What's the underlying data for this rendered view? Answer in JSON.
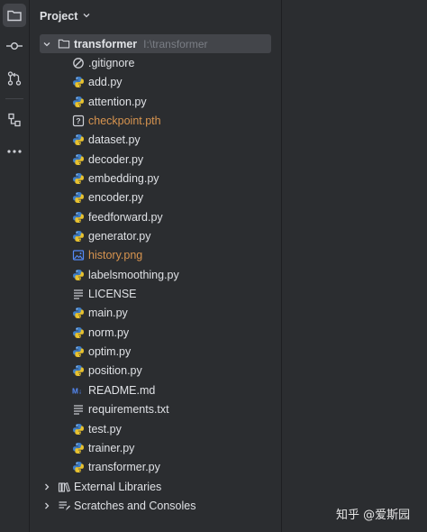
{
  "panel": {
    "title": "Project"
  },
  "root": {
    "name": "transformer",
    "path": "I:\\transformer"
  },
  "files": [
    {
      "name": ".gitignore",
      "icon": "gitignore-icon",
      "ignored": false
    },
    {
      "name": "add.py",
      "icon": "python-icon",
      "ignored": false
    },
    {
      "name": "attention.py",
      "icon": "python-icon",
      "ignored": false
    },
    {
      "name": "checkpoint.pth",
      "icon": "unknown-file-icon",
      "ignored": true
    },
    {
      "name": "dataset.py",
      "icon": "python-icon",
      "ignored": false
    },
    {
      "name": "decoder.py",
      "icon": "python-icon",
      "ignored": false
    },
    {
      "name": "embedding.py",
      "icon": "python-icon",
      "ignored": false
    },
    {
      "name": "encoder.py",
      "icon": "python-icon",
      "ignored": false
    },
    {
      "name": "feedforward.py",
      "icon": "python-icon",
      "ignored": false
    },
    {
      "name": "generator.py",
      "icon": "python-icon",
      "ignored": false
    },
    {
      "name": "history.png",
      "icon": "image-icon",
      "ignored": true
    },
    {
      "name": "labelsmoothing.py",
      "icon": "python-icon",
      "ignored": false
    },
    {
      "name": "LICENSE",
      "icon": "text-file-icon",
      "ignored": false
    },
    {
      "name": "main.py",
      "icon": "python-icon",
      "ignored": false
    },
    {
      "name": "norm.py",
      "icon": "python-icon",
      "ignored": false
    },
    {
      "name": "optim.py",
      "icon": "python-icon",
      "ignored": false
    },
    {
      "name": "position.py",
      "icon": "python-icon",
      "ignored": false
    },
    {
      "name": "README.md",
      "icon": "markdown-icon",
      "ignored": false
    },
    {
      "name": "requirements.txt",
      "icon": "text-file-icon",
      "ignored": false
    },
    {
      "name": "test.py",
      "icon": "python-icon",
      "ignored": false
    },
    {
      "name": "trainer.py",
      "icon": "python-icon",
      "ignored": false
    },
    {
      "name": "transformer.py",
      "icon": "python-icon",
      "ignored": false
    }
  ],
  "extra_nodes": [
    {
      "name": "External Libraries",
      "icon": "library-icon"
    },
    {
      "name": "Scratches and Consoles",
      "icon": "scratches-icon"
    }
  ],
  "watermark": {
    "text": "知乎 @爱斯园"
  },
  "colors": {
    "background": "#2b2d30",
    "selected_row": "#43454a",
    "ignored_text": "#d7944f",
    "path_text": "#7a7e85"
  }
}
